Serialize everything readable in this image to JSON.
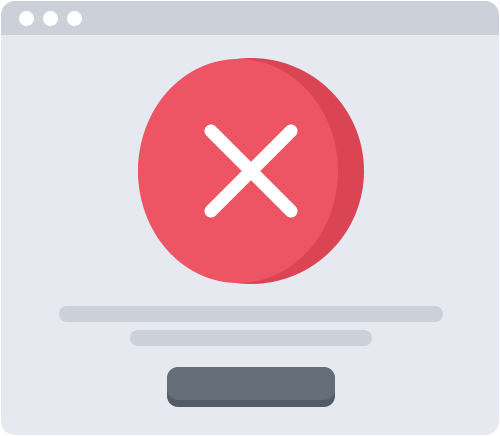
{
  "window": {
    "title_dots": [
      "close",
      "minimize",
      "maximize"
    ]
  },
  "dialog": {
    "icon": "close-icon",
    "icon_style": "error-cross-in-circle",
    "text_lines": [
      "",
      ""
    ],
    "button_label": ""
  },
  "colors": {
    "window_bg": "#e6e9ef",
    "titlebar": "#ccd0d9",
    "error_red": "#ed5565",
    "error_red_dark": "#da4453",
    "button": "#656d78",
    "button_shadow": "#545b64"
  }
}
